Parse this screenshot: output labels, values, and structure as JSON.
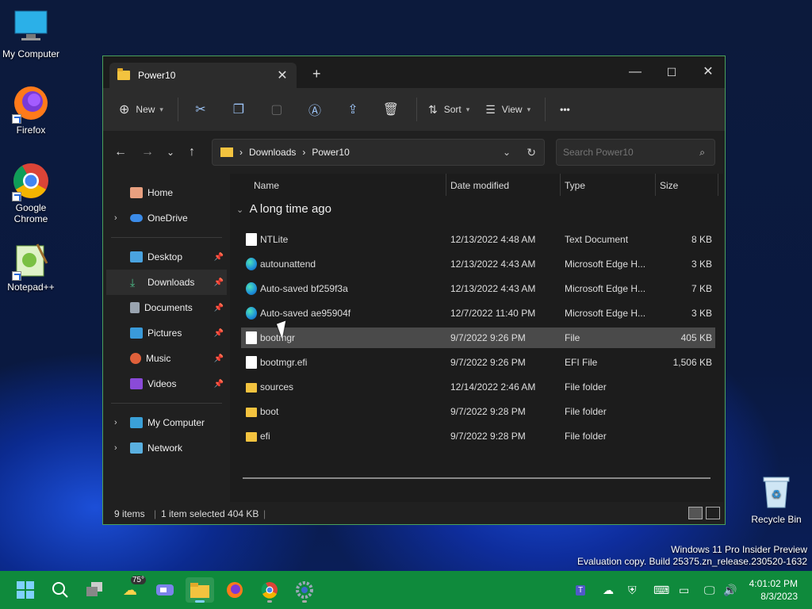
{
  "desktop": {
    "icons": [
      {
        "label": "My Computer",
        "icon": "monitor-icon"
      },
      {
        "label": "Firefox",
        "icon": "firefox-icon"
      },
      {
        "label": "Google Chrome",
        "icon": "chrome-icon"
      },
      {
        "label": "Notepad++",
        "icon": "notepadpp-icon"
      }
    ],
    "recycle_label": "Recycle Bin",
    "watermark_line1": "Windows 11 Pro Insider Preview",
    "watermark_line2": "Evaluation copy. Build 25375.zn_release.230520-1632"
  },
  "window": {
    "tab_title": "Power10",
    "new_tab": "+",
    "minimize": "—",
    "maximize": "☐",
    "close": "✕",
    "accent_border": "#4aa05a"
  },
  "toolbar": {
    "new_label": "New",
    "sort_label": "Sort",
    "view_label": "View",
    "more": "•••"
  },
  "address": {
    "crumbs": [
      "Downloads",
      "Power10"
    ],
    "search_placeholder": "Search Power10"
  },
  "sidebar": {
    "items": [
      {
        "label": "Home",
        "icon": "home-icon",
        "chevron": "",
        "pinned": false
      },
      {
        "label": "OneDrive",
        "icon": "onedrive-icon",
        "chevron": "›",
        "pinned": false
      },
      {
        "label": "Desktop",
        "icon": "desktop-icon",
        "chevron": "",
        "pinned": true
      },
      {
        "label": "Downloads",
        "icon": "download-icon",
        "chevron": "",
        "pinned": true,
        "selected": true
      },
      {
        "label": "Documents",
        "icon": "documents-icon",
        "chevron": "",
        "pinned": true
      },
      {
        "label": "Pictures",
        "icon": "pictures-icon",
        "chevron": "",
        "pinned": true
      },
      {
        "label": "Music",
        "icon": "music-icon",
        "chevron": "",
        "pinned": true
      },
      {
        "label": "Videos",
        "icon": "videos-icon",
        "chevron": "",
        "pinned": true
      },
      {
        "label": "My Computer",
        "icon": "computer-icon",
        "chevron": "›",
        "pinned": false
      },
      {
        "label": "Network",
        "icon": "network-icon",
        "chevron": "›",
        "pinned": false
      }
    ]
  },
  "files": {
    "columns": [
      "Name",
      "Date modified",
      "Type",
      "Size"
    ],
    "group": "A long time ago",
    "rows": [
      {
        "name": "NTLite",
        "date": "12/13/2022 4:48 AM",
        "type": "Text Document",
        "size": "8 KB",
        "icon": "doc"
      },
      {
        "name": "autounattend",
        "date": "12/13/2022 4:43 AM",
        "type": "Microsoft Edge H...",
        "size": "3 KB",
        "icon": "edge"
      },
      {
        "name": "Auto-saved bf259f3a",
        "date": "12/13/2022 4:43 AM",
        "type": "Microsoft Edge H...",
        "size": "7 KB",
        "icon": "edge"
      },
      {
        "name": "Auto-saved ae95904f",
        "date": "12/7/2022 11:40 PM",
        "type": "Microsoft Edge H...",
        "size": "3 KB",
        "icon": "edge"
      },
      {
        "name": "bootmgr",
        "date": "9/7/2022 9:26 PM",
        "type": "File",
        "size": "405 KB",
        "icon": "doc",
        "selected": true
      },
      {
        "name": "bootmgr.efi",
        "date": "9/7/2022 9:26 PM",
        "type": "EFI File",
        "size": "1,506 KB",
        "icon": "doc"
      },
      {
        "name": "sources",
        "date": "12/14/2022 2:46 AM",
        "type": "File folder",
        "size": "",
        "icon": "folder"
      },
      {
        "name": "boot",
        "date": "9/7/2022 9:28 PM",
        "type": "File folder",
        "size": "",
        "icon": "folder"
      },
      {
        "name": "efi",
        "date": "9/7/2022 9:28 PM",
        "type": "File folder",
        "size": "",
        "icon": "folder"
      }
    ]
  },
  "status": {
    "count": "9 items",
    "selection": "1 item selected  404 KB"
  },
  "taskbar": {
    "weather_temp": "75°",
    "time": "4:01:02 PM",
    "date": "8/3/2023",
    "color": "#0f8a3c"
  }
}
